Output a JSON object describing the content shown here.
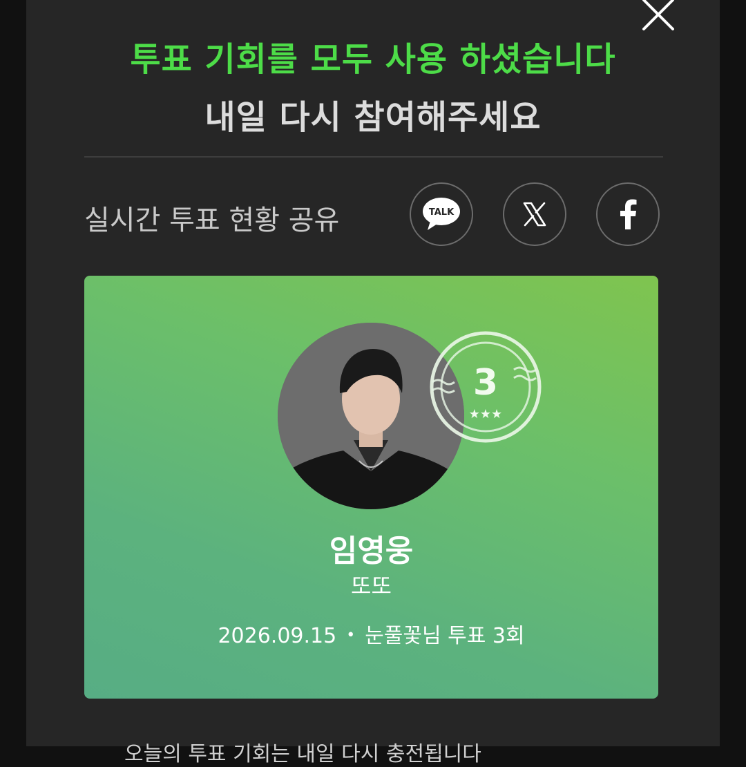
{
  "header": {
    "headline": "투표 기회를 모두 사용 하셨습니다",
    "subline": "내일 다시 참여해주세요"
  },
  "share": {
    "label": "실시간 투표 현황 공유",
    "kakao_label": "TALK",
    "buttons": [
      "kakaotalk-icon",
      "x-icon",
      "facebook-icon"
    ]
  },
  "card": {
    "stamp_count": "3",
    "artist": "임영웅",
    "song": "또또",
    "date": "2026.09.15",
    "vote_summary": "눈풀꽃님 투표 3회",
    "gradient": [
      "#7fc44f",
      "#57ad84"
    ]
  },
  "footer": {
    "partial_text": "오늘의 투표 기회는 내일 다시 충전됩니다"
  },
  "colors": {
    "accent": "#4ddc48",
    "panel_bg": "#262626"
  }
}
